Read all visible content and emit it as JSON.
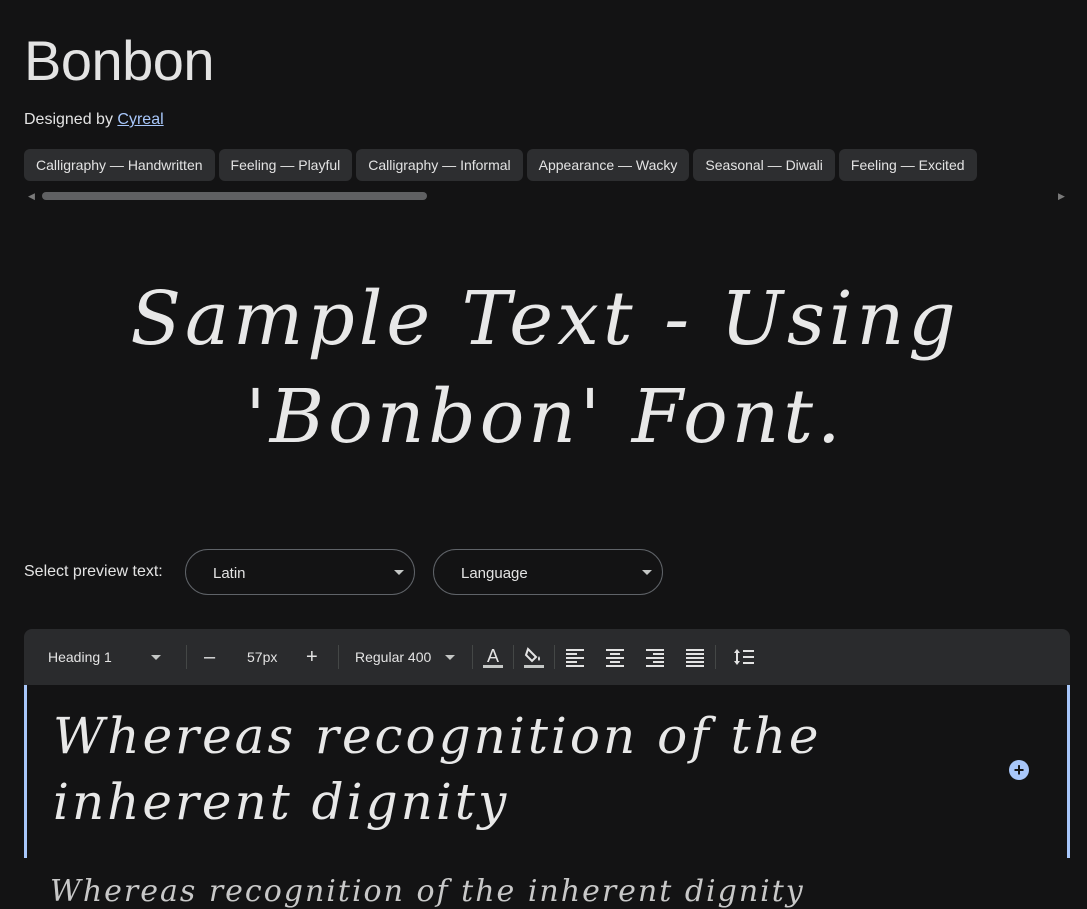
{
  "font": {
    "name": "Bonbon",
    "designed_by_label": "Designed by",
    "designer": "Cyreal"
  },
  "tags": [
    "Calligraphy — Handwritten",
    "Feeling — Playful",
    "Calligraphy — Informal",
    "Appearance — Wacky",
    "Seasonal — Diwali",
    "Feeling — Excited"
  ],
  "sample_text": "Sample Text - Using 'Bonbon' Font.",
  "preview": {
    "label": "Select preview text:",
    "script_value": "Latin",
    "language_value": "Language"
  },
  "toolbar": {
    "style": "Heading 1",
    "decrease": "–",
    "size": "57px",
    "increase": "+",
    "weight": "Regular 400"
  },
  "editor": {
    "text": "Whereas recognition of the inherent dignity",
    "next_line": "Whereas recognition of the inherent dignity"
  },
  "colors": {
    "background": "#131314",
    "accent": "#a8c7fa",
    "chip": "#2d2e30"
  }
}
